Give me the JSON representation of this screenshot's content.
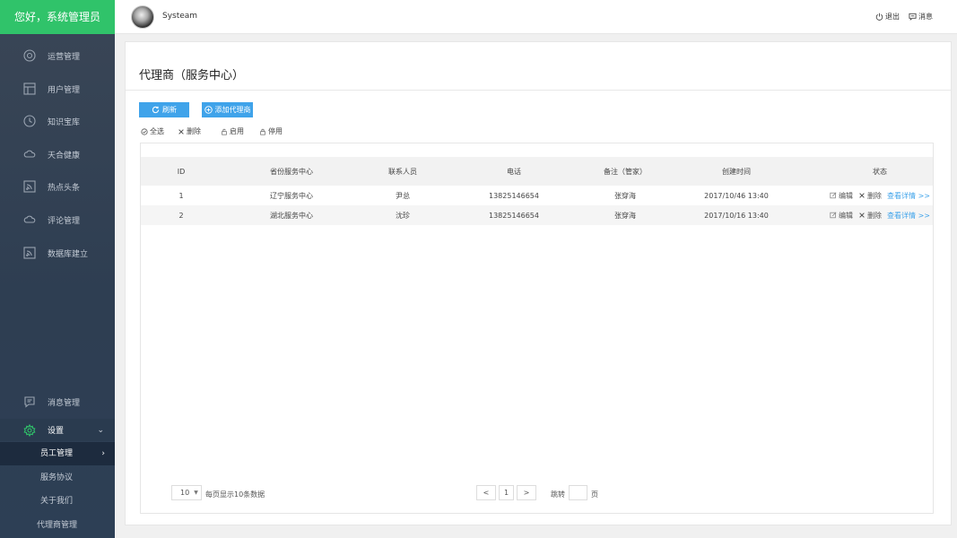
{
  "brand": {
    "greeting": "您好，系统管理员"
  },
  "header": {
    "username": "Systeam",
    "logout_label": "退出",
    "message_label": "消息"
  },
  "sidebar": {
    "items": [
      {
        "label": "运营管理",
        "icon": "target-icon"
      },
      {
        "label": "用户管理",
        "icon": "grid-icon"
      },
      {
        "label": "知识宝库",
        "icon": "clock-icon"
      },
      {
        "label": "天合健康",
        "icon": "cloud-icon"
      },
      {
        "label": "热点头条",
        "icon": "rss-icon"
      },
      {
        "label": "评论管理",
        "icon": "cloud-icon"
      },
      {
        "label": "数据库建立",
        "icon": "rss-icon"
      }
    ],
    "message_mgmt": {
      "label": "消息管理",
      "icon": "chat-icon"
    },
    "settings": {
      "label": "设置",
      "icon": "gear-icon",
      "sub_items": [
        {
          "label": "员工管理",
          "active": true
        },
        {
          "label": "服务协议",
          "active": false
        },
        {
          "label": "关于我们",
          "active": false
        },
        {
          "label": "代理商管理",
          "active": false
        }
      ]
    }
  },
  "main": {
    "title": "代理商（服务中心）",
    "buttons": {
      "refresh": "刷新",
      "add_agent": "添加代理商"
    },
    "tools": {
      "select_all": "全选",
      "delete": "删除",
      "enable": "启用",
      "disable": "停用"
    },
    "table": {
      "columns": [
        "ID",
        "省份服务中心",
        "联系人员",
        "电话",
        "备注（管家）",
        "创建时间",
        "状态"
      ],
      "rows": [
        {
          "id": "1",
          "center": "辽宁服务中心",
          "contact": "尹总",
          "phone": "13825146654",
          "note": "张穿海",
          "created": "2017/10/46 13:40"
        },
        {
          "id": "2",
          "center": "湖北服务中心",
          "contact": "沈珍",
          "phone": "13825146654",
          "note": "张穿海",
          "created": "2017/10/16 13:40"
        }
      ],
      "actions": {
        "edit": "编辑",
        "delete": "删除",
        "detail": "查看详情 >>"
      }
    },
    "pagination": {
      "page_size": "10",
      "page_size_text": "每页显示10条数据",
      "prev": "<",
      "current_page": "1",
      "next": ">",
      "jump_label": "跳转",
      "jump_value": "",
      "page_unit": "页"
    }
  },
  "colors": {
    "brand_green": "#30c36a",
    "accent_blue": "#3fa3ea",
    "sidebar_bg": "#2e3e52"
  }
}
